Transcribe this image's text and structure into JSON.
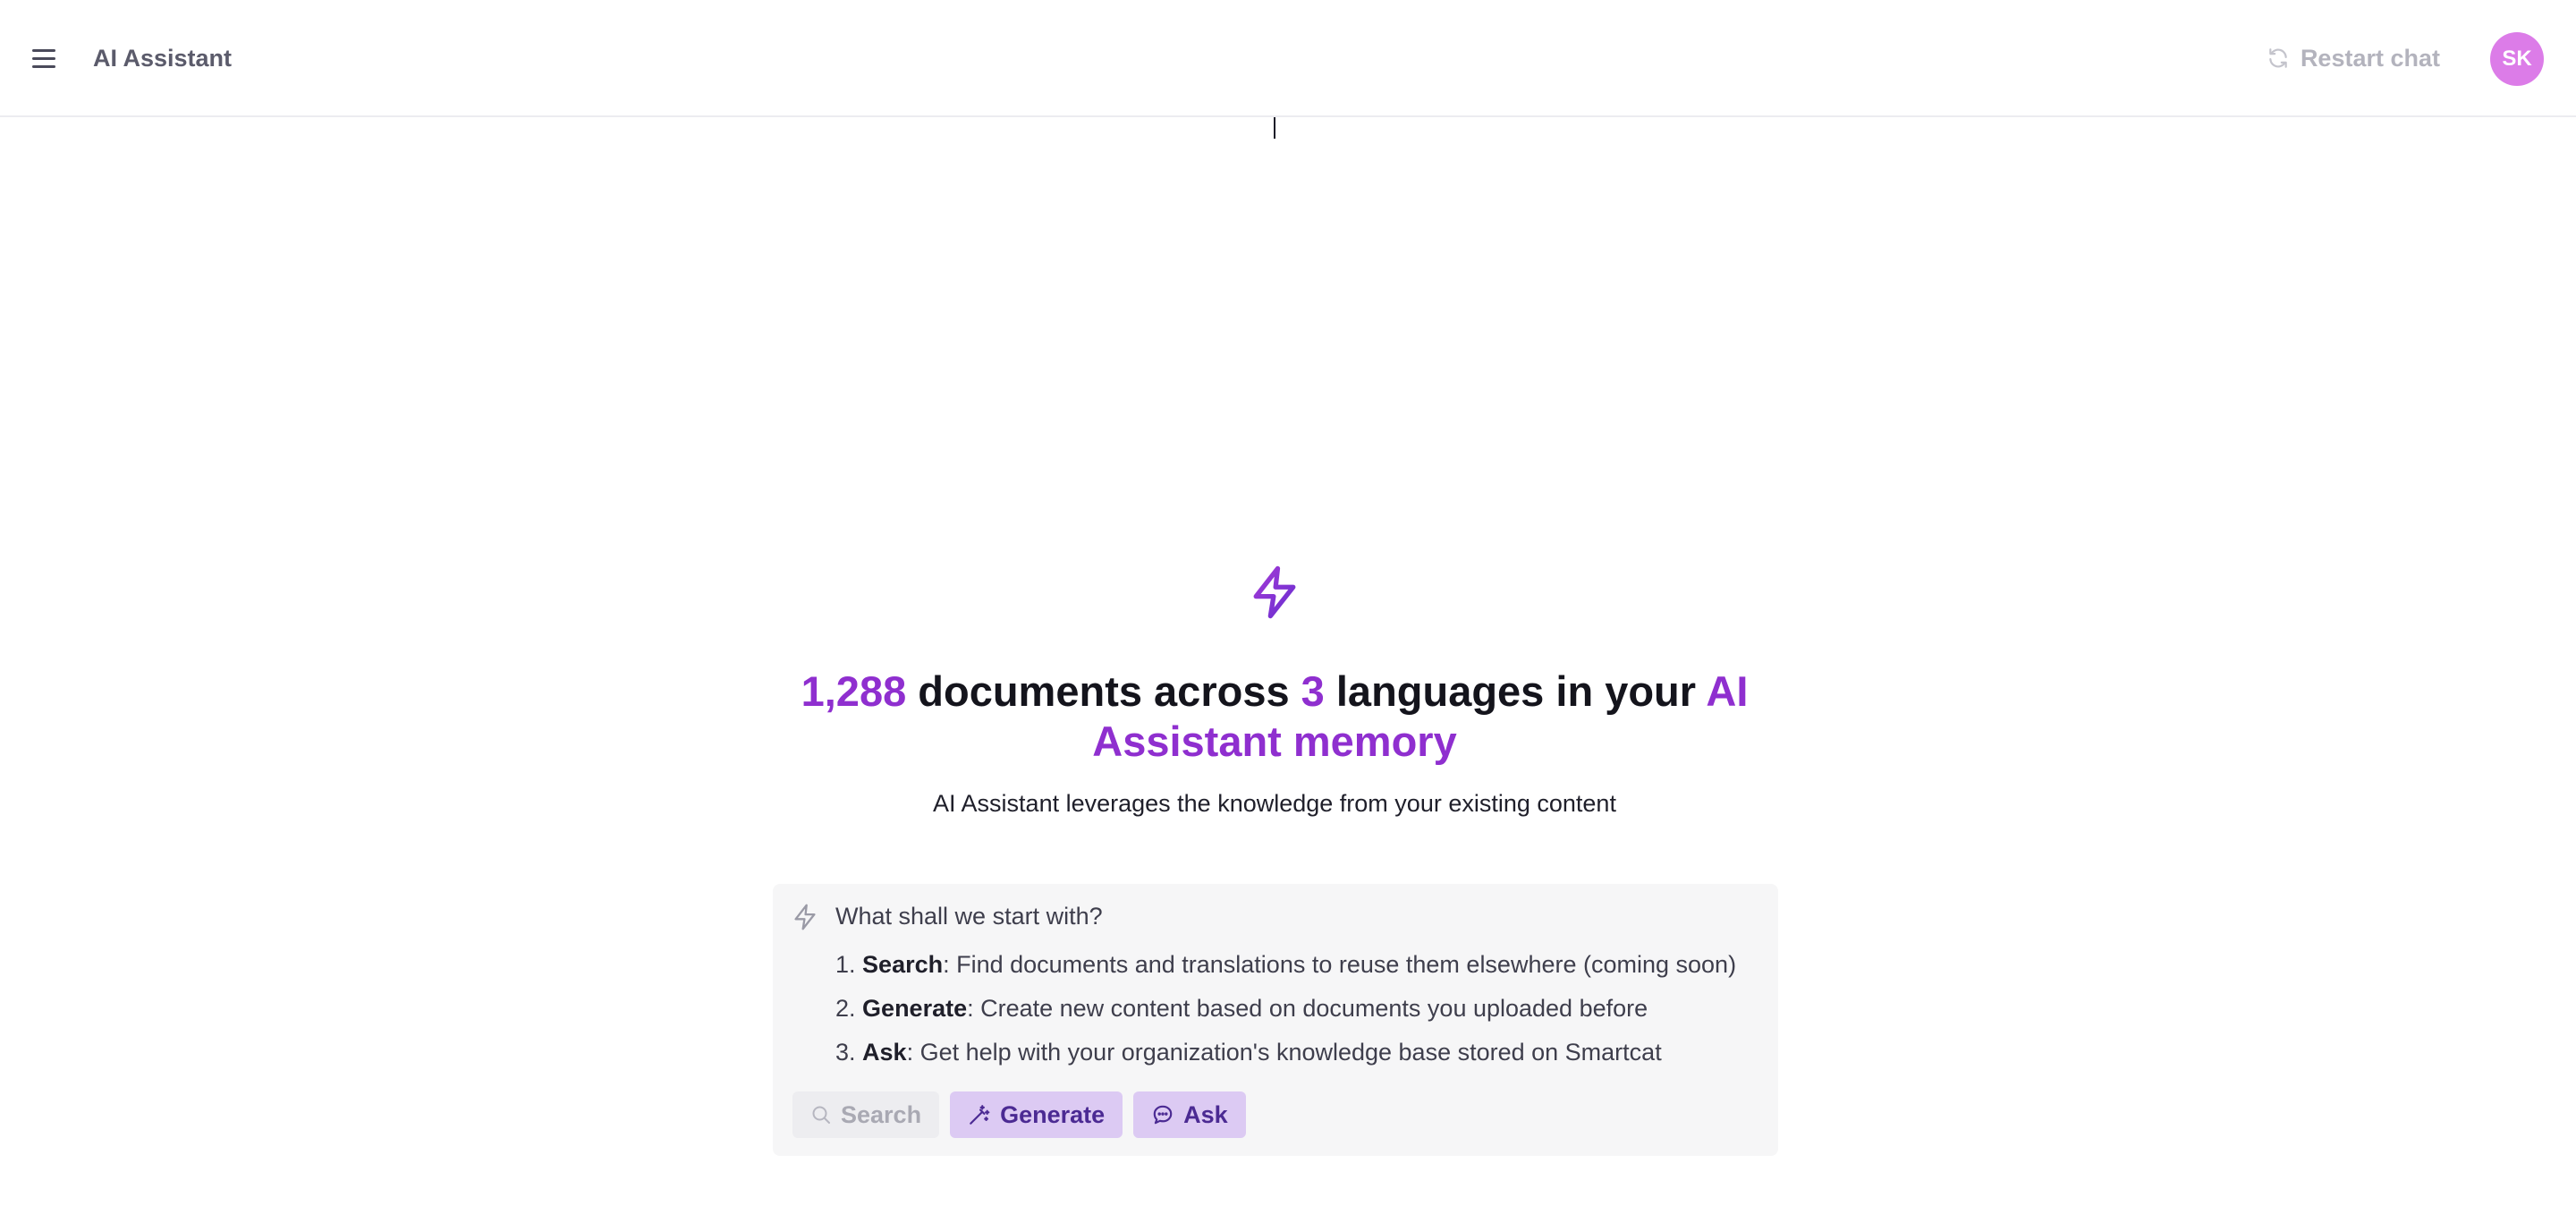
{
  "header": {
    "app_title": "AI Assistant",
    "menu_icon": "hamburger-menu-icon",
    "restart_label": "Restart chat",
    "restart_icon": "refresh-icon",
    "avatar_initials": "SK",
    "avatar_color": "#dc7ce8"
  },
  "hero": {
    "icon": "lightning-bolt-icon",
    "doc_count": "1,288",
    "text_documents_across": " documents across ",
    "lang_count": "3",
    "text_languages_in_your": " languages in your ",
    "memory_label": "AI Assistant memory",
    "subtitle": "AI Assistant leverages the knowledge from your existing content",
    "accent_color": "#8f2fcf"
  },
  "suggestions": {
    "icon": "lightning-bolt-icon",
    "prompt": "What shall we start with?",
    "items": [
      {
        "number": "1.",
        "title": "Search",
        "description": ": Find documents and translations to reuse them elsewhere (coming soon)"
      },
      {
        "number": "2.",
        "title": "Generate",
        "description": ": Create new content based on documents you uploaded before"
      },
      {
        "number": "3.",
        "title": "Ask",
        "description": ": Get help with your organization's knowledge base stored on Smartcat"
      }
    ],
    "buttons": {
      "search": {
        "label": "Search",
        "icon": "search-icon",
        "state": "disabled"
      },
      "generate": {
        "label": "Generate",
        "icon": "magic-wand-icon",
        "state": "enabled"
      },
      "ask": {
        "label": "Ask",
        "icon": "chat-bubble-icon",
        "state": "enabled"
      }
    }
  }
}
